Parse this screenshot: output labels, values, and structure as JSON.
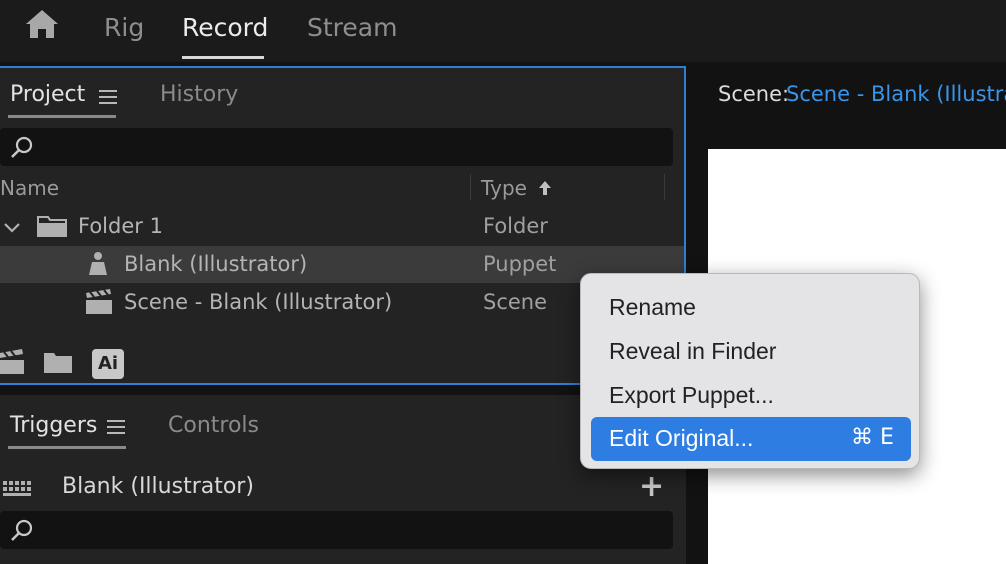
{
  "workspace_tabs": [
    {
      "label": "Rig",
      "active": false
    },
    {
      "label": "Record",
      "active": true
    },
    {
      "label": "Stream",
      "active": false
    }
  ],
  "project_panel": {
    "tabs": [
      {
        "label": "Project"
      },
      {
        "label": "History"
      }
    ],
    "columns": {
      "name": "Name",
      "type": "Type"
    },
    "rows": [
      {
        "name": "Folder 1",
        "type": "Folder",
        "icon": "folder-icon"
      },
      {
        "name": "Blank (Illustrator)",
        "type": "Puppet",
        "icon": "puppet-icon",
        "selected": true
      },
      {
        "name": "Scene - Blank (Illustrator)",
        "type": "Scene",
        "icon": "clapperboard-icon"
      }
    ],
    "ai_badge": "Ai"
  },
  "triggers_panel": {
    "tabs": [
      {
        "label": "Triggers"
      },
      {
        "label": "Controls"
      }
    ],
    "puppet_name": "Blank (Illustrator)",
    "add_label": "+"
  },
  "scene": {
    "label": "Scene:",
    "name": "Scene - Blank (Illustrator)"
  },
  "context_menu": {
    "items": [
      {
        "label": "Rename"
      },
      {
        "label": "Reveal in Finder"
      },
      {
        "label": "Export Puppet..."
      },
      {
        "label": "Edit Original...",
        "shortcut": "⌘ E",
        "highlighted": true
      }
    ]
  },
  "colors": {
    "accent": "#2f7fd4",
    "link": "#3a95e8",
    "menu_highlight": "#2e7de3"
  }
}
